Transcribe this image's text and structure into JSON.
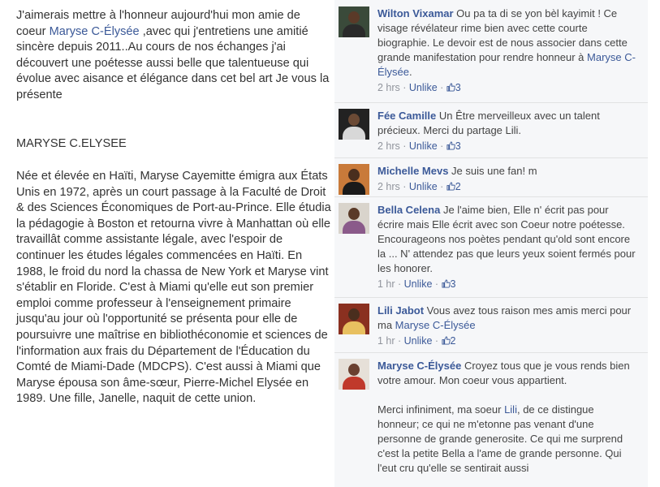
{
  "post": {
    "intro_before": "J'aimerais mettre à l'honneur aujourd'hui mon amie de coeur ",
    "intro_link": "Maryse C-Élysée",
    "intro_after": " ,avec qui j'entretiens une amitié sincère depuis 2011..Au cours de nos échanges j'ai découvert une poétesse aussi belle que talentueuse qui évolue avec aisance et élégance dans cet bel art Je vous la présente",
    "heading": "MARYSE C.ELYSEE",
    "bio": "Née et élevée en Haïti, Maryse Cayemitte émigra aux États Unis en 1972, après un court passage à la Faculté de Droit & des Sciences Économiques de Port-au-Prince. Elle étudia la pédagogie à Boston et retourna vivre à Manhattan où elle travaillât comme assistante légale, avec l'espoir de continuer les études légales commencées en Haïti. En 1988, le froid du nord la chassa de New York et Maryse vint s'établir en Floride. C'est à Miami qu'elle eut son premier emploi comme professeur à l'enseignement primaire jusqu'au jour où l'opportunité se présenta pour elle de poursuivre une maîtrise en bibliothéconomie et sciences de l'information aux frais du Département de l'Éducation du Comté de Miami-Dade (MDCPS). C'est aussi à Miami que Maryse épousa son âme-sœur, Pierre-Michel Elysée en 1989. Une fille, Janelle, naquit de cette union."
  },
  "comments": [
    {
      "author": "Wilton Vixamar",
      "text": " Ou pa ta di se yon bèl kayimit ! Ce visage révélateur rime bien avec cette courte biographie. Le devoir est de nous associer dans cette grande manifestation pour rendre honneur à ",
      "mention": "Maryse C-Élysée",
      "text_after": ".",
      "time": "2 hrs",
      "action": "Unlike",
      "likes": "3",
      "avatar_bg": "#3a4a3a",
      "skin": "#5a3a28",
      "shirt": "#2a2a2a"
    },
    {
      "author": "Fée Camille",
      "text": " Un Être merveilleux avec un talent précieux. Merci du partage Lili.",
      "mention": "",
      "text_after": "",
      "time": "2 hrs",
      "action": "Unlike",
      "likes": "3",
      "avatar_bg": "#222222",
      "skin": "#6b4a35",
      "shirt": "#d8d8d8"
    },
    {
      "author": "Michelle Mevs",
      "text": " Je suis une fan! m",
      "mention": "",
      "text_after": "",
      "time": "2 hrs",
      "action": "Unlike",
      "likes": "2",
      "avatar_bg": "#c97a3a",
      "skin": "#4a2e1e",
      "shirt": "#1a1a1a"
    },
    {
      "author": "Bella Celena",
      "text": " Je l'aime bien, Elle n' écrit pas pour écrire mais Elle écrit avec son Coeur notre poétesse. Encourageons nos poètes pendant qu'old sont encore la ... N' attendez pas que leurs yeux soient fermés pour les honorer.",
      "mention": "",
      "text_after": "",
      "time": "1 hr",
      "action": "Unlike",
      "likes": "3",
      "avatar_bg": "#d9d4cc",
      "skin": "#5a3a28",
      "shirt": "#8a5a8a"
    },
    {
      "author": "Lili Jabot",
      "text": " Vous avez tous raison mes amis merci pour ma ",
      "mention": "Maryse C-Élysée",
      "text_after": "",
      "time": "1 hr",
      "action": "Unlike",
      "likes": "2",
      "avatar_bg": "#8a3020",
      "skin": "#4a2e1e",
      "shirt": "#e8c060"
    },
    {
      "author": "Maryse C-Élysée",
      "text": " Croyez tous que je vous rends bien votre amour. Mon coeur vous appartient.",
      "mention": "",
      "text_after": "",
      "continuation_before": "Merci infiniment, ma soeur ",
      "continuation_link": "Lili",
      "continuation_after": ", de ce distingue honneur; ce qui ne m'etonne pas venant d'une personne de grande generosite. Ce qui me surprend c'est la petite Bella a l'ame de grande personne. Qui l'eut cru qu'elle se sentirait aussi",
      "avatar_bg": "#e6e0d8",
      "skin": "#6a4030",
      "shirt": "#c0392b"
    }
  ],
  "colors": {
    "link": "#3b5998",
    "panel_bg": "#f6f7f9",
    "meta": "#90949c"
  }
}
